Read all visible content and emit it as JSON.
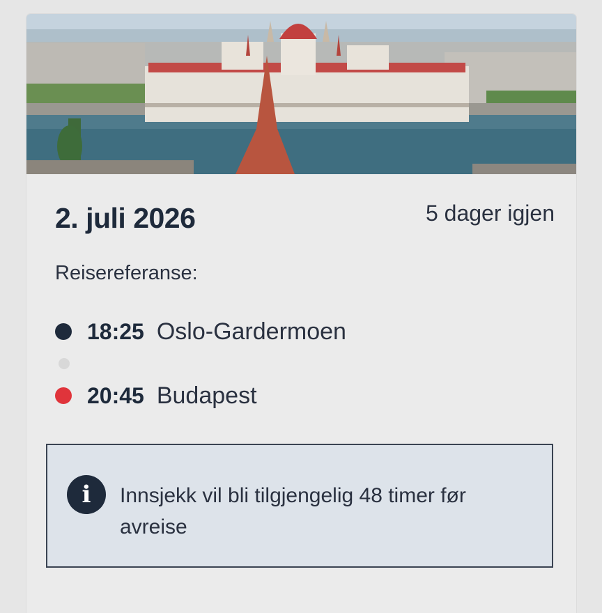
{
  "trip": {
    "date": "2. juli 2026",
    "countdown": "5 dager igjen",
    "reference_label": "Reisereferanse:",
    "departure": {
      "time": "18:25",
      "place": "Oslo-Gardermoen"
    },
    "arrival": {
      "time": "20:45",
      "place": "Budapest"
    }
  },
  "info": {
    "icon": "info-icon",
    "text": "Innsjekk vil bli tilgjengelig 48 timer før avreise"
  },
  "colors": {
    "primary": "#1e2a3b",
    "arrival_dot": "#e0343b",
    "info_bg": "#dde3ea"
  }
}
